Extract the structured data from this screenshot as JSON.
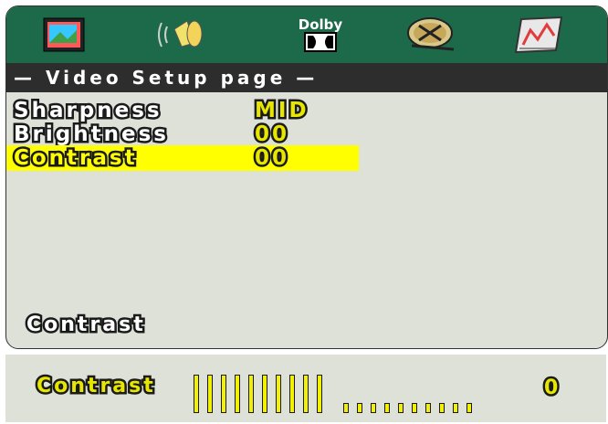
{
  "header": {
    "icons": [
      "tv-setup-icon",
      "audio-speaker-icon",
      "dolby-icon",
      "video-reel-icon",
      "preference-chart-icon"
    ],
    "dolby_label": "Dolby"
  },
  "page_title": "— Video Setup page —",
  "settings": [
    {
      "label": "Sharpness",
      "value": "MID"
    },
    {
      "label": "Brightness",
      "value": "00"
    },
    {
      "label": "Contrast",
      "value": "00"
    }
  ],
  "selected_index": 2,
  "help_text": "Contrast",
  "adjust": {
    "label": "Contrast",
    "value": "0",
    "tick_count": 20,
    "level_fraction": 0.5
  },
  "colors": {
    "icon_bar": "#1d6a4a",
    "title_bar": "#2d2d2d",
    "highlight": "#ffff00",
    "panel": "#dde1d8"
  }
}
